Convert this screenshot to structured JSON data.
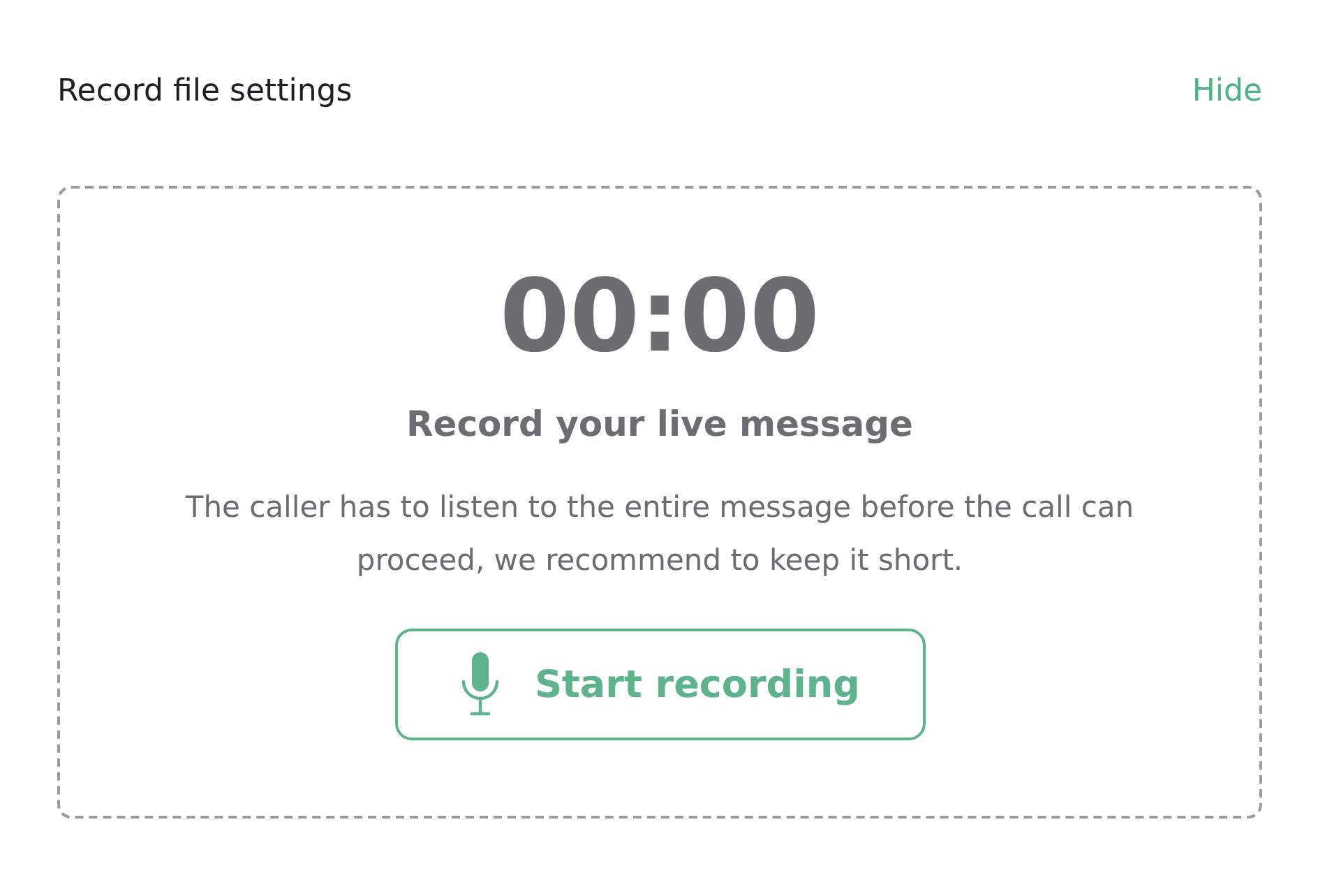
{
  "header": {
    "title": "Record file settings",
    "action": "Hide"
  },
  "recorder": {
    "timer": "00:00",
    "heading": "Record your live message",
    "description": "The caller has to listen to the entire message before the call can proceed, we recommend to keep it short.",
    "button": "Start recording"
  }
}
